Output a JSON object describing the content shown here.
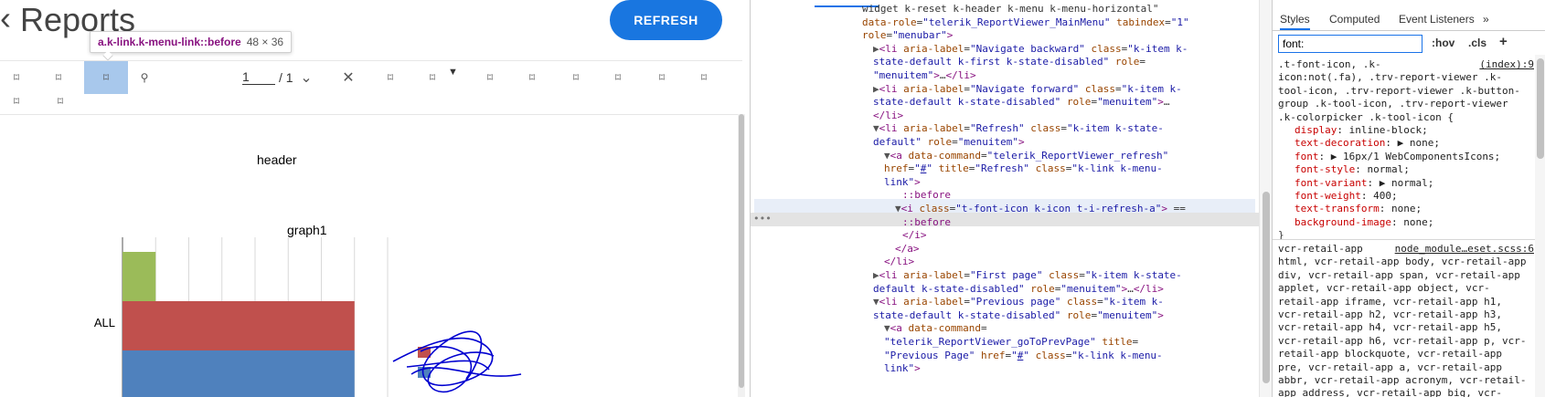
{
  "app": {
    "title": "Reports",
    "refresh_button": "REFRESH",
    "tooltip": {
      "selector": "a.k-link.k-menu-link::before",
      "dims": "48 × 36"
    },
    "pager": {
      "current": "1",
      "total": "/ 1"
    },
    "report_header": "header",
    "graph_title": "graph1"
  },
  "chart_data": {
    "type": "bar",
    "orientation": "horizontal",
    "categories": [
      "ALL"
    ],
    "series": [
      {
        "values": [
          1
        ],
        "color": "#9bbb59"
      },
      {
        "values": [
          7
        ],
        "color": "#c0504d"
      },
      {
        "values": [
          7
        ],
        "color": "#4f81bd"
      }
    ],
    "xlim": [
      0,
      8
    ],
    "grid": true,
    "title": "graph1"
  },
  "elements_panel": {
    "lines": [
      {
        "indent": 0,
        "html": "<span class='txt'>widget k-reset k-header k-menu k-menu-horizontal\"</span>"
      },
      {
        "indent": 0,
        "html": "<span class='attr'>data-role</span><span class='txt'>=</span><span class='val'>\"telerik_ReportViewer_MainMenu\"</span> <span class='attr'>tabindex</span><span class='txt'>=</span><span class='val'>\"1\"</span>"
      },
      {
        "indent": 0,
        "html": "<span class='attr'>role</span><span class='txt'>=</span><span class='val'>\"menubar\"</span><span class='tag'>&gt;</span>"
      },
      {
        "indent": 1,
        "html": "<span class='tri'>▶</span><span class='tag'>&lt;li</span> <span class='attr'>aria-label</span><span class='txt'>=</span><span class='val'>\"Navigate backward\"</span> <span class='attr'>class</span><span class='txt'>=</span><span class='val'>\"k-item k-</span>"
      },
      {
        "indent": 1,
        "html": "<span class='val'>state-default k-first k-state-disabled\"</span> <span class='attr'>role</span><span class='txt'>=</span>"
      },
      {
        "indent": 1,
        "html": "<span class='val'>\"menuitem\"</span><span class='tag'>&gt;</span><span class='txt'>…</span><span class='tag'>&lt;/li&gt;</span>"
      },
      {
        "indent": 1,
        "html": "<span class='tri'>▶</span><span class='tag'>&lt;li</span> <span class='attr'>aria-label</span><span class='txt'>=</span><span class='val'>\"Navigate forward\"</span> <span class='attr'>class</span><span class='txt'>=</span><span class='val'>\"k-item k-</span>"
      },
      {
        "indent": 1,
        "html": "<span class='val'>state-default k-state-disabled\"</span> <span class='attr'>role</span><span class='txt'>=</span><span class='val'>\"menuitem\"</span><span class='tag'>&gt;</span><span class='txt'>…</span>"
      },
      {
        "indent": 1,
        "html": "<span class='tag'>&lt;/li&gt;</span>"
      },
      {
        "indent": 1,
        "html": "<span class='tri'>▼</span><span class='tag'>&lt;li</span> <span class='attr'>aria-label</span><span class='txt'>=</span><span class='val'>\"Refresh\"</span> <span class='attr'>class</span><span class='txt'>=</span><span class='val'>\"k-item k-state-</span>"
      },
      {
        "indent": 1,
        "html": "<span class='val'>default\"</span> <span class='attr'>role</span><span class='txt'>=</span><span class='val'>\"menuitem\"</span><span class='tag'>&gt;</span>"
      },
      {
        "indent": 2,
        "html": "<span class='tri'>▼</span><span class='tag'>&lt;a</span> <span class='attr'>data-command</span><span class='txt'>=</span><span class='val'>\"telerik_ReportViewer_refresh\"</span>"
      },
      {
        "indent": 2,
        "html": "<span class='attr'>href</span><span class='txt'>=</span><span class='val'>\"<u>#</u>\"</span> <span class='attr'>title</span><span class='txt'>=</span><span class='val'>\"Refresh\"</span> <span class='attr'>class</span><span class='txt'>=</span><span class='val'>\"k-link k-menu-</span>"
      },
      {
        "indent": 2,
        "html": "<span class='val'>link\"</span><span class='tag'>&gt;</span>"
      },
      {
        "indent": 4,
        "html": "<span class='pseudo'>::before</span>"
      },
      {
        "indent": 3,
        "html": "<span class='tri'>▼</span><span class='tag'>&lt;i</span> <span class='attr'>class</span><span class='txt'>=</span><span class='val'>\"t-font-icon k-icon t-i-refresh-a\"</span><span class='tag'>&gt;</span> <span class='txt'>==</span>"
      },
      {
        "indent": 4,
        "html": "<span class='pseudo'>::before</span>"
      },
      {
        "indent": 4,
        "html": "<span class='tag'>&lt;/i&gt;</span>"
      },
      {
        "indent": 3,
        "html": "<span class='tag'>&lt;/a&gt;</span>"
      },
      {
        "indent": 2,
        "html": "<span class='tag'>&lt;/li&gt;</span>"
      },
      {
        "indent": 1,
        "html": "<span class='tri'>▶</span><span class='tag'>&lt;li</span> <span class='attr'>aria-label</span><span class='txt'>=</span><span class='val'>\"First page\"</span> <span class='attr'>class</span><span class='txt'>=</span><span class='val'>\"k-item k-state-</span>"
      },
      {
        "indent": 1,
        "html": "<span class='val'>default k-state-disabled\"</span> <span class='attr'>role</span><span class='txt'>=</span><span class='val'>\"menuitem\"</span><span class='tag'>&gt;</span><span class='txt'>…</span><span class='tag'>&lt;/li&gt;</span>"
      },
      {
        "indent": 1,
        "html": "<span class='tri'>▼</span><span class='tag'>&lt;li</span> <span class='attr'>aria-label</span><span class='txt'>=</span><span class='val'>\"Previous page\"</span> <span class='attr'>class</span><span class='txt'>=</span><span class='val'>\"k-item k-</span>"
      },
      {
        "indent": 1,
        "html": "<span class='val'>state-default k-state-disabled\"</span> <span class='attr'>role</span><span class='txt'>=</span><span class='val'>\"menuitem\"</span><span class='tag'>&gt;</span>"
      },
      {
        "indent": 2,
        "html": "<span class='tri'>▼</span><span class='tag'>&lt;a</span> <span class='attr'>data-command</span><span class='txt'>=</span>"
      },
      {
        "indent": 2,
        "html": "<span class='val'>\"telerik_ReportViewer_goToPrevPage\"</span> <span class='attr'>title</span><span class='txt'>=</span>"
      },
      {
        "indent": 2,
        "html": "<span class='val'>\"Previous Page\"</span> <span class='attr'>href</span><span class='txt'>=</span><span class='val'>\"<u>#</u>\"</span> <span class='attr'>class</span><span class='txt'>=</span><span class='val'>\"k-link k-menu-</span>"
      },
      {
        "indent": 2,
        "html": "<span class='val'>link\"</span><span class='tag'>&gt;</span>"
      }
    ]
  },
  "styles_panel": {
    "tabs": [
      "Styles",
      "Computed",
      "Event Listeners",
      "»"
    ],
    "filter_value": "font:",
    "hov": ":hov",
    "cls": ".cls",
    "plus": "+",
    "rule1": {
      "selector_lines": [
        ".t-font-icon, .k-",
        "icon:not(.fa), .trv-report-viewer .k-",
        "tool-icon, .trv-report-viewer .k-button-",
        "group .k-tool-icon, .trv-report-viewer",
        ".k-colorpicker .k-tool-icon {"
      ],
      "source": "(index):9",
      "declarations": [
        {
          "prop": "display",
          "value": "inline-block;"
        },
        {
          "prop": "text-decoration",
          "value": "▶ none;"
        },
        {
          "prop": "font",
          "value": "▶ 16px/1 WebComponentsIcons;"
        },
        {
          "prop": "font-style",
          "value": "normal;"
        },
        {
          "prop": "font-variant",
          "value": "▶ normal;"
        },
        {
          "prop": "font-weight",
          "value": "400;"
        },
        {
          "prop": "text-transform",
          "value": "none;"
        },
        {
          "prop": "background-image",
          "value": "none;"
        }
      ],
      "close": "}"
    },
    "rule2": {
      "source": "node_module…eset.scss:6",
      "selector_lines": [
        "vcr-retail-app",
        "html, vcr-retail-app body, vcr-retail-app",
        "div, vcr-retail-app span, vcr-retail-app",
        "applet, vcr-retail-app object, vcr-",
        "retail-app iframe, vcr-retail-app h1,",
        "vcr-retail-app h2, vcr-retail-app h3,",
        "vcr-retail-app h4, vcr-retail-app h5,",
        "vcr-retail-app h6, vcr-retail-app p, vcr-",
        "retail-app blockquote, vcr-retail-app",
        "pre, vcr-retail-app a, vcr-retail-app",
        "abbr, vcr-retail-app acronym, vcr-retail-",
        "app address, vcr-retail-app big, vcr-"
      ]
    }
  }
}
